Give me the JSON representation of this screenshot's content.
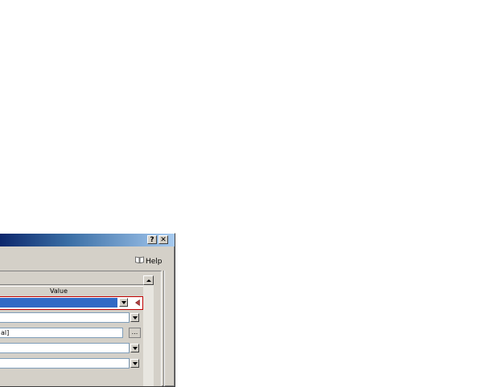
{
  "titlebar": {
    "help_button_label": "?",
    "close_button_label": "✕"
  },
  "help_link": {
    "label": "Help",
    "icon": "book-icon"
  },
  "property_grid": {
    "column_header": "Value",
    "rows": [
      {
        "kind": "dropdown",
        "value": "",
        "selected": true
      },
      {
        "kind": "dropdown",
        "value": ""
      },
      {
        "kind": "text-with-button",
        "value": "al]",
        "button_label": "..."
      },
      {
        "kind": "dropdown",
        "value": ""
      },
      {
        "kind": "dropdown",
        "value": ""
      }
    ]
  },
  "colors": {
    "selection": "#316ac5",
    "selected_border": "#c00000",
    "window_face": "#d4d0c8",
    "title_gradient_start": "#0a246a",
    "title_gradient_end": "#a6caf0"
  }
}
